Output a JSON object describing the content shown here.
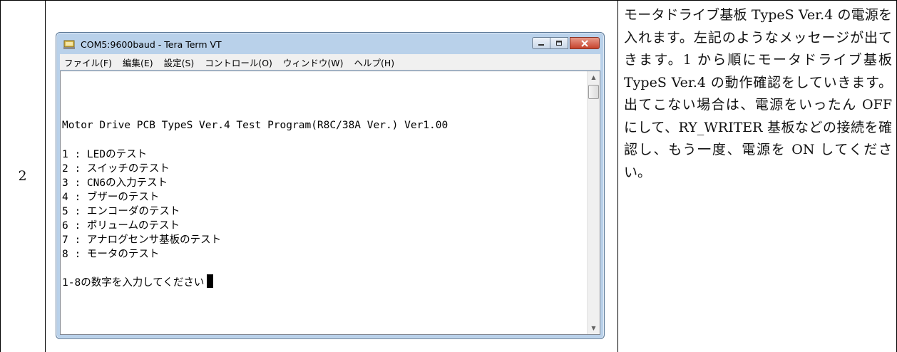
{
  "step": {
    "number": "2"
  },
  "window": {
    "title": "COM5:9600baud - Tera Term VT",
    "menu": [
      "ファイル(F)",
      "編集(E)",
      "設定(S)",
      "コントロール(O)",
      "ウィンドウ(W)",
      "ヘルプ(H)"
    ]
  },
  "terminal": {
    "header": "Motor Drive PCB TypeS Ver.4 Test Program(R8C/38A Ver.) Ver1.00",
    "items": [
      "1 : LEDのテスト",
      "2 : スイッチのテスト",
      "3 : CN6の入力テスト",
      "4 : ブザーのテスト",
      "5 : エンコーダのテスト",
      "6 : ボリュームのテスト",
      "7 : アナログセンサ基板のテスト",
      "8 : モータのテスト"
    ],
    "prompt": "1-8の数字を入力してください"
  },
  "description": "モータドライブ基板 TypeS Ver.4 の電源を入れます。左記のようなメッセージが出てきます。1 から順にモータドライブ基板 TypeS Ver.4 の動作確認をしていきます。出てこない場合は、電源をいったん OFF にして、RY_WRITER 基板などの接続を確認し、もう一度、電源を ON してください。"
}
